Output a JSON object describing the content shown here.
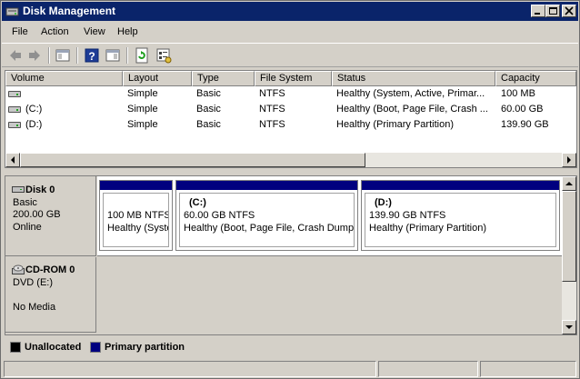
{
  "window": {
    "title": "Disk Management",
    "icon": "disk-management-icon"
  },
  "menu": {
    "items": [
      "File",
      "Action",
      "View",
      "Help"
    ]
  },
  "toolbar": {
    "buttons": [
      "back-icon",
      "forward-icon",
      "show-hide-tree-icon",
      "help-icon",
      "properties-icon",
      "refresh-icon",
      "settings-icon"
    ]
  },
  "volume_list": {
    "columns": [
      "Volume",
      "Layout",
      "Type",
      "File System",
      "Status",
      "Capacity"
    ],
    "rows": [
      {
        "volume": "",
        "layout": "Simple",
        "type": "Basic",
        "fs": "NTFS",
        "status": "Healthy (System, Active, Primar...",
        "capacity": "100 MB"
      },
      {
        "volume": "(C:)",
        "layout": "Simple",
        "type": "Basic",
        "fs": "NTFS",
        "status": "Healthy (Boot, Page File, Crash ...",
        "capacity": "60.00 GB"
      },
      {
        "volume": "(D:)",
        "layout": "Simple",
        "type": "Basic",
        "fs": "NTFS",
        "status": "Healthy (Primary Partition)",
        "capacity": "139.90 GB"
      }
    ]
  },
  "disks": [
    {
      "name": "Disk 0",
      "type": "Basic",
      "size": "200.00 GB",
      "state": "Online",
      "partitions": [
        {
          "label": "",
          "size_fs": "100 MB NTFS",
          "status": "Healthy (Syste"
        },
        {
          "label": "(C:)",
          "size_fs": "60.00 GB NTFS",
          "status": "Healthy (Boot, Page File, Crash Dump,"
        },
        {
          "label": "(D:)",
          "size_fs": "139.90 GB NTFS",
          "status": "Healthy (Primary Partition)"
        }
      ]
    },
    {
      "name": "CD-ROM 0",
      "type": "DVD (E:)",
      "size": "",
      "state": "No Media"
    }
  ],
  "legend": {
    "items": [
      {
        "label": "Unallocated",
        "color": "#000000"
      },
      {
        "label": "Primary partition",
        "color": "#00007f"
      }
    ]
  },
  "colors": {
    "titlebar": "#0a246a",
    "primary_partition": "#00007f",
    "unallocated": "#000000",
    "chrome": "#d4d0c8"
  }
}
